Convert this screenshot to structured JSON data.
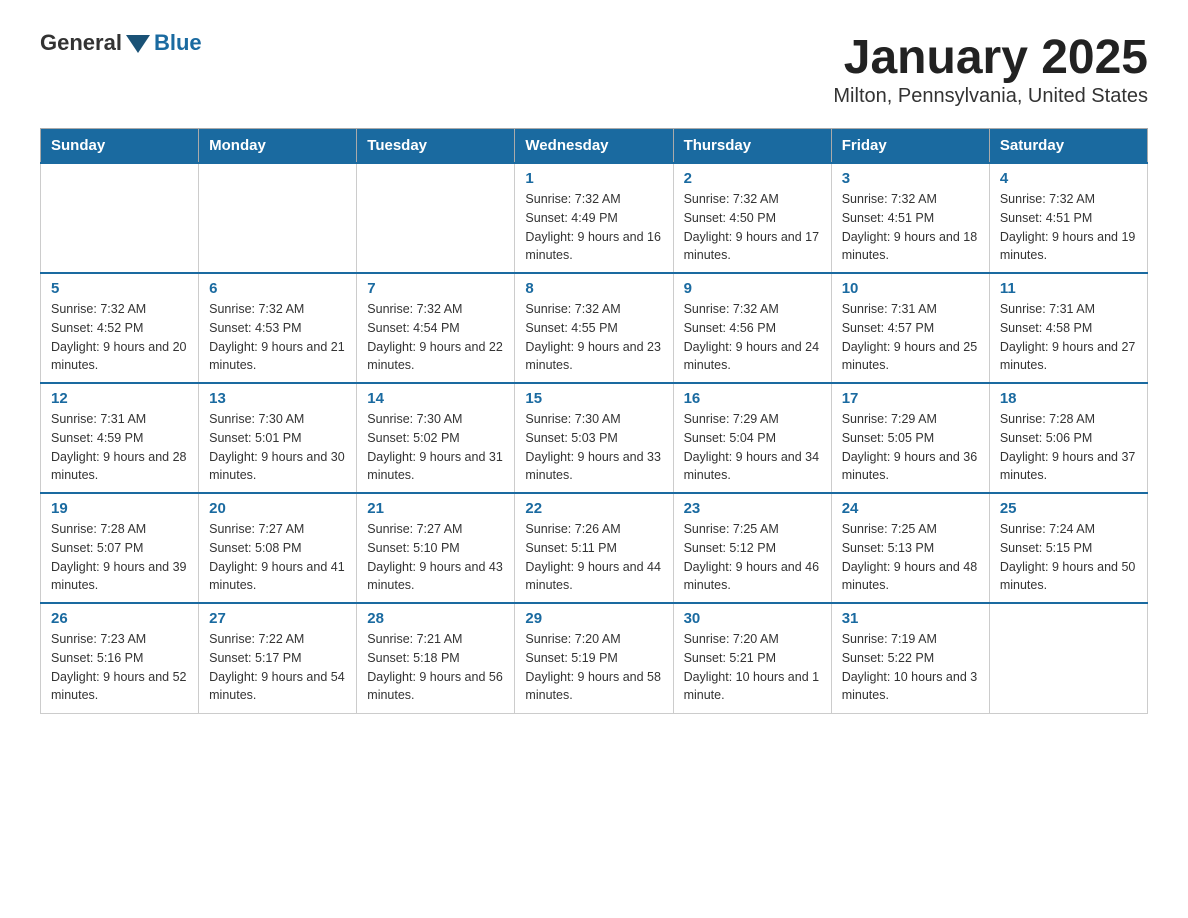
{
  "header": {
    "logo_general": "General",
    "logo_blue": "Blue",
    "title": "January 2025",
    "subtitle": "Milton, Pennsylvania, United States"
  },
  "days_of_week": [
    "Sunday",
    "Monday",
    "Tuesday",
    "Wednesday",
    "Thursday",
    "Friday",
    "Saturday"
  ],
  "weeks": [
    [
      {
        "day": "",
        "sunrise": "",
        "sunset": "",
        "daylight": ""
      },
      {
        "day": "",
        "sunrise": "",
        "sunset": "",
        "daylight": ""
      },
      {
        "day": "",
        "sunrise": "",
        "sunset": "",
        "daylight": ""
      },
      {
        "day": "1",
        "sunrise": "Sunrise: 7:32 AM",
        "sunset": "Sunset: 4:49 PM",
        "daylight": "Daylight: 9 hours and 16 minutes."
      },
      {
        "day": "2",
        "sunrise": "Sunrise: 7:32 AM",
        "sunset": "Sunset: 4:50 PM",
        "daylight": "Daylight: 9 hours and 17 minutes."
      },
      {
        "day": "3",
        "sunrise": "Sunrise: 7:32 AM",
        "sunset": "Sunset: 4:51 PM",
        "daylight": "Daylight: 9 hours and 18 minutes."
      },
      {
        "day": "4",
        "sunrise": "Sunrise: 7:32 AM",
        "sunset": "Sunset: 4:51 PM",
        "daylight": "Daylight: 9 hours and 19 minutes."
      }
    ],
    [
      {
        "day": "5",
        "sunrise": "Sunrise: 7:32 AM",
        "sunset": "Sunset: 4:52 PM",
        "daylight": "Daylight: 9 hours and 20 minutes."
      },
      {
        "day": "6",
        "sunrise": "Sunrise: 7:32 AM",
        "sunset": "Sunset: 4:53 PM",
        "daylight": "Daylight: 9 hours and 21 minutes."
      },
      {
        "day": "7",
        "sunrise": "Sunrise: 7:32 AM",
        "sunset": "Sunset: 4:54 PM",
        "daylight": "Daylight: 9 hours and 22 minutes."
      },
      {
        "day": "8",
        "sunrise": "Sunrise: 7:32 AM",
        "sunset": "Sunset: 4:55 PM",
        "daylight": "Daylight: 9 hours and 23 minutes."
      },
      {
        "day": "9",
        "sunrise": "Sunrise: 7:32 AM",
        "sunset": "Sunset: 4:56 PM",
        "daylight": "Daylight: 9 hours and 24 minutes."
      },
      {
        "day": "10",
        "sunrise": "Sunrise: 7:31 AM",
        "sunset": "Sunset: 4:57 PM",
        "daylight": "Daylight: 9 hours and 25 minutes."
      },
      {
        "day": "11",
        "sunrise": "Sunrise: 7:31 AM",
        "sunset": "Sunset: 4:58 PM",
        "daylight": "Daylight: 9 hours and 27 minutes."
      }
    ],
    [
      {
        "day": "12",
        "sunrise": "Sunrise: 7:31 AM",
        "sunset": "Sunset: 4:59 PM",
        "daylight": "Daylight: 9 hours and 28 minutes."
      },
      {
        "day": "13",
        "sunrise": "Sunrise: 7:30 AM",
        "sunset": "Sunset: 5:01 PM",
        "daylight": "Daylight: 9 hours and 30 minutes."
      },
      {
        "day": "14",
        "sunrise": "Sunrise: 7:30 AM",
        "sunset": "Sunset: 5:02 PM",
        "daylight": "Daylight: 9 hours and 31 minutes."
      },
      {
        "day": "15",
        "sunrise": "Sunrise: 7:30 AM",
        "sunset": "Sunset: 5:03 PM",
        "daylight": "Daylight: 9 hours and 33 minutes."
      },
      {
        "day": "16",
        "sunrise": "Sunrise: 7:29 AM",
        "sunset": "Sunset: 5:04 PM",
        "daylight": "Daylight: 9 hours and 34 minutes."
      },
      {
        "day": "17",
        "sunrise": "Sunrise: 7:29 AM",
        "sunset": "Sunset: 5:05 PM",
        "daylight": "Daylight: 9 hours and 36 minutes."
      },
      {
        "day": "18",
        "sunrise": "Sunrise: 7:28 AM",
        "sunset": "Sunset: 5:06 PM",
        "daylight": "Daylight: 9 hours and 37 minutes."
      }
    ],
    [
      {
        "day": "19",
        "sunrise": "Sunrise: 7:28 AM",
        "sunset": "Sunset: 5:07 PM",
        "daylight": "Daylight: 9 hours and 39 minutes."
      },
      {
        "day": "20",
        "sunrise": "Sunrise: 7:27 AM",
        "sunset": "Sunset: 5:08 PM",
        "daylight": "Daylight: 9 hours and 41 minutes."
      },
      {
        "day": "21",
        "sunrise": "Sunrise: 7:27 AM",
        "sunset": "Sunset: 5:10 PM",
        "daylight": "Daylight: 9 hours and 43 minutes."
      },
      {
        "day": "22",
        "sunrise": "Sunrise: 7:26 AM",
        "sunset": "Sunset: 5:11 PM",
        "daylight": "Daylight: 9 hours and 44 minutes."
      },
      {
        "day": "23",
        "sunrise": "Sunrise: 7:25 AM",
        "sunset": "Sunset: 5:12 PM",
        "daylight": "Daylight: 9 hours and 46 minutes."
      },
      {
        "day": "24",
        "sunrise": "Sunrise: 7:25 AM",
        "sunset": "Sunset: 5:13 PM",
        "daylight": "Daylight: 9 hours and 48 minutes."
      },
      {
        "day": "25",
        "sunrise": "Sunrise: 7:24 AM",
        "sunset": "Sunset: 5:15 PM",
        "daylight": "Daylight: 9 hours and 50 minutes."
      }
    ],
    [
      {
        "day": "26",
        "sunrise": "Sunrise: 7:23 AM",
        "sunset": "Sunset: 5:16 PM",
        "daylight": "Daylight: 9 hours and 52 minutes."
      },
      {
        "day": "27",
        "sunrise": "Sunrise: 7:22 AM",
        "sunset": "Sunset: 5:17 PM",
        "daylight": "Daylight: 9 hours and 54 minutes."
      },
      {
        "day": "28",
        "sunrise": "Sunrise: 7:21 AM",
        "sunset": "Sunset: 5:18 PM",
        "daylight": "Daylight: 9 hours and 56 minutes."
      },
      {
        "day": "29",
        "sunrise": "Sunrise: 7:20 AM",
        "sunset": "Sunset: 5:19 PM",
        "daylight": "Daylight: 9 hours and 58 minutes."
      },
      {
        "day": "30",
        "sunrise": "Sunrise: 7:20 AM",
        "sunset": "Sunset: 5:21 PM",
        "daylight": "Daylight: 10 hours and 1 minute."
      },
      {
        "day": "31",
        "sunrise": "Sunrise: 7:19 AM",
        "sunset": "Sunset: 5:22 PM",
        "daylight": "Daylight: 10 hours and 3 minutes."
      },
      {
        "day": "",
        "sunrise": "",
        "sunset": "",
        "daylight": ""
      }
    ]
  ]
}
